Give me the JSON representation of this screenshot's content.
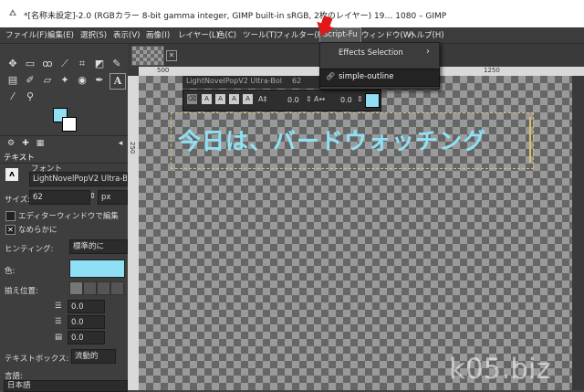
{
  "window": {
    "title": "*[名称未設定]-2.0 (RGBカラー 8-bit gamma integer, GIMP built-in sRGB, 2枚のレイヤー) 19… 1080 – GIMP"
  },
  "menubar": {
    "items": [
      "ファイル(F)",
      "編集(E)",
      "選択(S)",
      "表示(V)",
      "画像(I)",
      "レイヤー(L)",
      "色(C)",
      "ツール(T)",
      "フィルター(R)",
      "Script-Fu",
      "ウィンドウ(W)",
      "ヘルプ(H)"
    ]
  },
  "script_fu_menu": {
    "items": [
      {
        "label": "Effects Selection",
        "has_submenu": true
      },
      {
        "label": "simple-outline",
        "highlighted": true
      }
    ]
  },
  "tool_options": {
    "tab_title": "テキスト",
    "font_label": "フォント",
    "font_value": "LightNovelPopV2 Ultra-Bold",
    "size_label": "サイズ:",
    "size_value": "62",
    "size_unit": "px",
    "use_editor_label": "エディターウィンドウで編集",
    "antialias_label": "なめらかに",
    "hinting_label": "ヒンティング:",
    "hinting_value": "標準的に",
    "color_label": "色:",
    "color_value": "#8fe0f5",
    "justify_label": "揃え位置:",
    "indent_value": "0.0",
    "line_spacing_value": "0.0",
    "letter_spacing_value": "0.0",
    "box_label": "テキストボックス:",
    "box_value": "流動的",
    "language_label": "言語:",
    "language_value": "日本語"
  },
  "text_toolbox": {
    "font": "LightNovelPopV2 Ultra-Bol",
    "size": "62",
    "baseline": "0.0",
    "kerning": "0.0"
  },
  "canvas": {
    "text": "今日は、バードウォッチング",
    "ruler_top_labels": [
      "500",
      "1250"
    ],
    "ruler_left_labels": [
      "250"
    ]
  },
  "watermark": "k05.biz",
  "colors": {
    "text_fill": "#8fe0f5",
    "accent_arrow": "#e01818"
  }
}
